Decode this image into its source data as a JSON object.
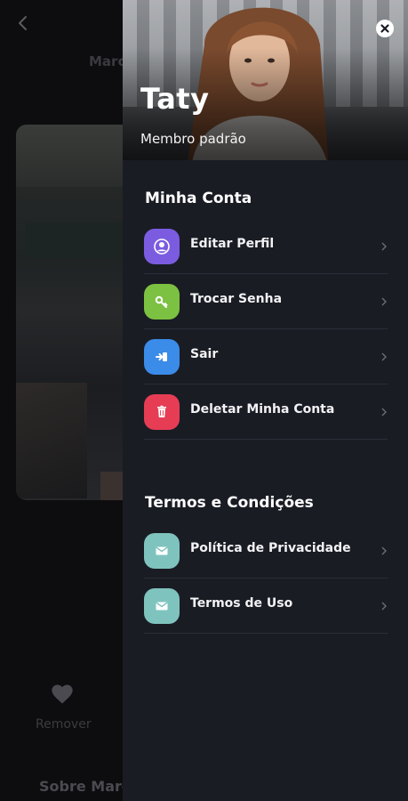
{
  "background": {
    "title": "Marc",
    "remove_label": "Remover",
    "about_title": "Sobre Marc"
  },
  "drawer": {
    "profile": {
      "name": "Taty",
      "role": "Membro padrão"
    },
    "sections": [
      {
        "title": "Minha Conta",
        "items": [
          {
            "label": "Editar Perfil",
            "icon": "user-icon",
            "color": "#7b5ce0"
          },
          {
            "label": "Trocar Senha",
            "icon": "key-icon",
            "color": "#7cc142"
          },
          {
            "label": "Sair",
            "icon": "logout-icon",
            "color": "#3b8be8"
          },
          {
            "label": "Deletar Minha Conta",
            "icon": "trash-icon",
            "color": "#e63d55"
          }
        ]
      },
      {
        "title": "Termos e Condições",
        "items": [
          {
            "label": "Política de Privacidade",
            "icon": "mail-icon",
            "color": "#7fc3be"
          },
          {
            "label": "Termos de Uso",
            "icon": "mail-icon",
            "color": "#7fc3be"
          }
        ]
      }
    ]
  },
  "colors": {
    "drawer_bg": "#1a1c24",
    "page_bg": "#0b0b0d"
  }
}
